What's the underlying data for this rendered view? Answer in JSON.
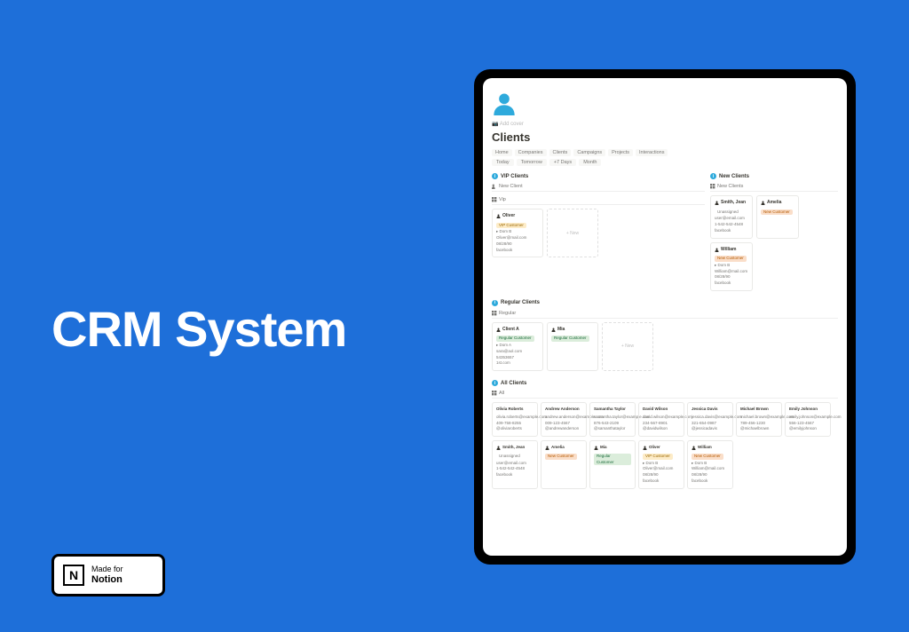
{
  "hero": {
    "title": "CRM System"
  },
  "badge": {
    "line1": "Made for",
    "line2": "Notion",
    "logo": "N"
  },
  "page": {
    "add_cover": "📷 Add cover",
    "title": "Clients",
    "breadcrumbs": [
      "Home",
      "Companies",
      "Clients",
      "Campaigns",
      "Projects",
      "Interactions"
    ],
    "filters": [
      "Today",
      "Tomorrow",
      "+7 Days",
      "Month"
    ]
  },
  "vip": {
    "header": "VIP Clients",
    "tab": "New Client",
    "view": "Vip",
    "card": {
      "name": "Oliver",
      "tag": "VIP Customer",
      "company": "Dom B",
      "email": "Oliver@mail.com",
      "date": "08/28/90",
      "social": "facebook"
    },
    "empty": "+ New"
  },
  "new": {
    "header": "New Clients",
    "view": "New Clients",
    "cards": [
      {
        "name": "Smith, Jean",
        "tag": "Unassigned",
        "email": "user@email.com",
        "phone": "1-542-542-4548",
        "social": "facebook"
      },
      {
        "name": "Amelia",
        "tag": "New Customer"
      },
      {
        "name": "William",
        "tag": "New Customer",
        "company": "Dom B",
        "email": "William@mail.com",
        "date": "08/28/90",
        "social": "facebook"
      }
    ]
  },
  "regular": {
    "header": "Regular Clients",
    "view": "Regular",
    "cards": [
      {
        "name": "Client A",
        "tag": "Regular Customer",
        "company": "Dom A",
        "email": "sara@aol.com",
        "phone": "54353657",
        "site": "1st.com"
      },
      {
        "name": "Mia",
        "tag": "Regular Customer"
      }
    ],
    "empty": "+ New"
  },
  "all": {
    "header": "All Clients",
    "view": "All",
    "row1": [
      {
        "name": "Olivia Roberts",
        "email": "olivia.roberts@example.com",
        "phone": "409-758-8255",
        "handle": "@oliviaroberts"
      },
      {
        "name": "Andrew Anderson",
        "email": "andrew.anderson@example.com",
        "phone": "009-123-4567",
        "handle": "@andrewanderson"
      },
      {
        "name": "Samantha Taylor",
        "email": "samantha.taylor@example.com",
        "phone": "876-543-2109",
        "handle": "@samanthataylor"
      },
      {
        "name": "David Wilson",
        "email": "david.wilson@example.com",
        "phone": "234-567-8901",
        "handle": "@davidwilson"
      },
      {
        "name": "Jessica Davis",
        "email": "jessica.davis@example.com",
        "phone": "321-654-0987",
        "handle": "@jessicadavis"
      },
      {
        "name": "Michael Brown",
        "email": "michael.brown@example.com",
        "phone": "789-456-1230",
        "handle": "@michaelbrown"
      },
      {
        "name": "Emily Johnson",
        "email": "emily.johnson@example.com",
        "phone": "556-123-4567",
        "handle": "@emilyjohnson"
      }
    ],
    "row2": [
      {
        "name": "Smith, Jean",
        "tag": "Unassigned",
        "email": "user@email.com",
        "phone": "1-542-542-4548",
        "social": "facebook"
      },
      {
        "name": "Amelia",
        "tag": "New Customer"
      },
      {
        "name": "Mia",
        "tag": "Regular Customer"
      },
      {
        "name": "Oliver",
        "tag": "VIP Customer",
        "company": "Dom B",
        "email": "Oliver@mail.com",
        "date": "08/28/90",
        "social": "facebook"
      },
      {
        "name": "William",
        "tag": "New Customer",
        "company": "Dom B",
        "email": "William@mail.com",
        "date": "08/28/90",
        "social": "facebook"
      }
    ]
  }
}
